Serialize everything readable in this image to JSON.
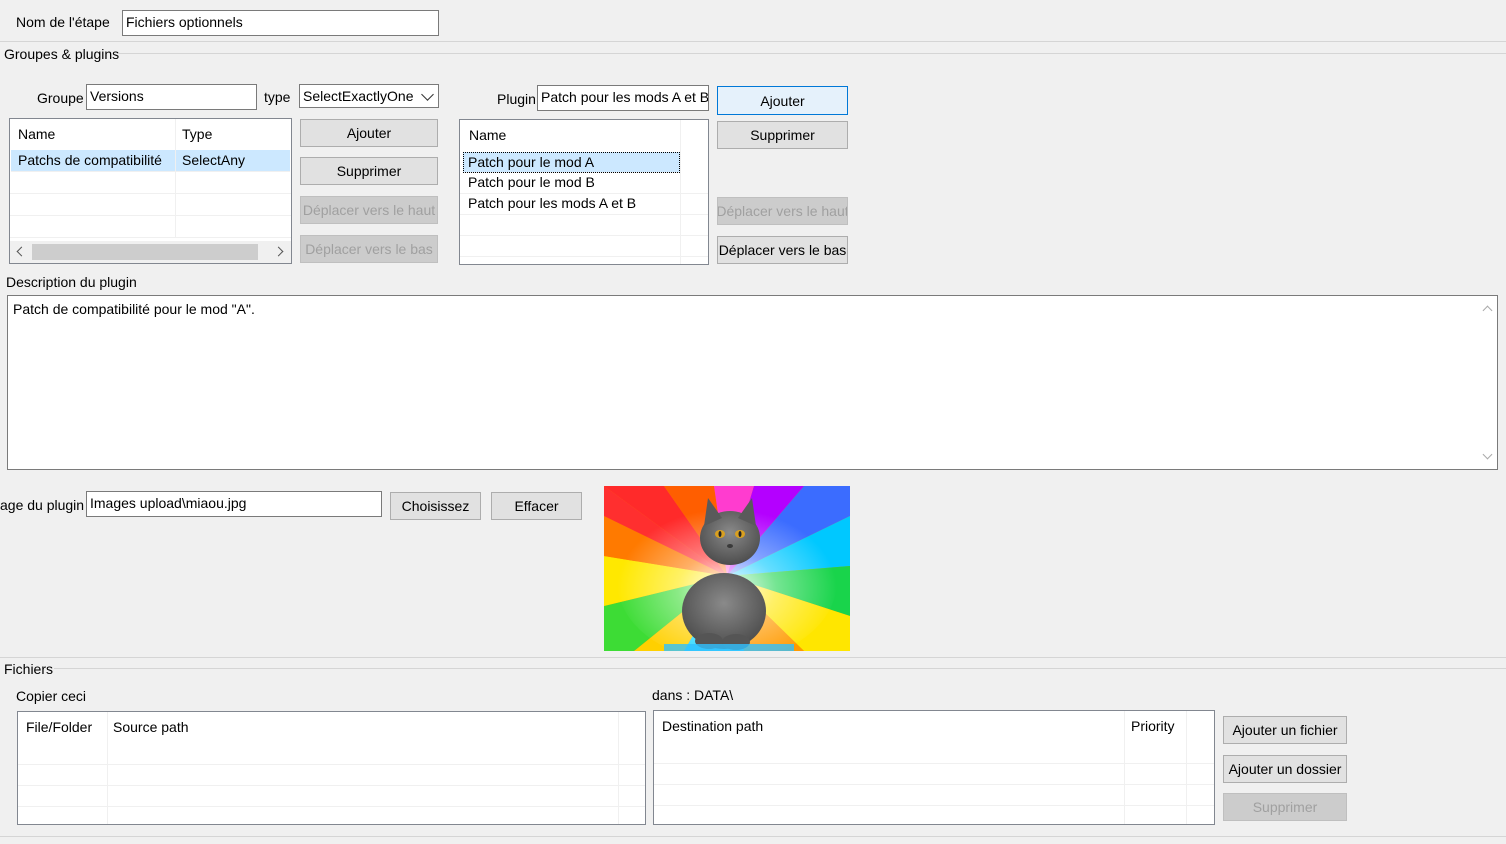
{
  "step": {
    "label": "Nom de l'étape",
    "value": "Fichiers optionnels"
  },
  "groups_section": {
    "title": "Groupes & plugins"
  },
  "group": {
    "label": "Groupe",
    "value": "Versions",
    "type_label": "type",
    "type_value": "SelectExactlyOne",
    "columns": [
      "Name",
      "Type"
    ],
    "rows": [
      {
        "name": "Patchs de compatibilité",
        "type": "SelectAny"
      }
    ],
    "buttons": {
      "add": "Ajouter",
      "remove": "Supprimer",
      "move_up": "Déplacer vers le haut",
      "move_down": "Déplacer vers le bas"
    }
  },
  "plugin": {
    "label": "Plugin",
    "value": "Patch pour les mods A et B",
    "columns": [
      "Name"
    ],
    "rows": [
      "Patch pour le mod A",
      "Patch pour le mod B",
      "Patch pour les mods A et B"
    ],
    "buttons": {
      "add": "Ajouter",
      "remove": "Supprimer",
      "move_up": "Déplacer vers le haut",
      "move_down": "Déplacer vers le bas"
    }
  },
  "description": {
    "label": "Description du plugin",
    "text": "Patch de compatibilité pour le mod \"A\"."
  },
  "image": {
    "label": "age du plugin",
    "value": "Images upload\\miaou.jpg",
    "choose": "Choisissez",
    "clear": "Effacer"
  },
  "files": {
    "title": "Fichiers",
    "copy_label": "Copier ceci",
    "dest_label": "dans : DATA\\",
    "source_columns": [
      "File/Folder",
      "Source path"
    ],
    "dest_columns": [
      "Destination path",
      "Priority"
    ],
    "buttons": {
      "add_file": "Ajouter un fichier",
      "add_folder": "Ajouter un dossier",
      "remove": "Supprimer"
    }
  }
}
